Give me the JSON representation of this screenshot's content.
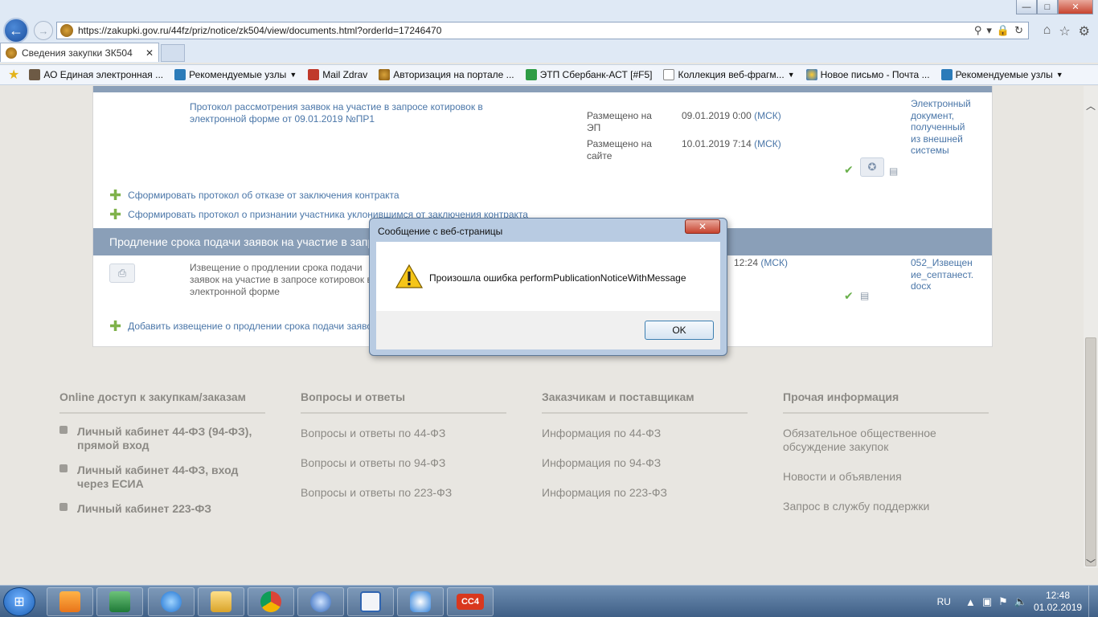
{
  "browser": {
    "url": "https://zakupki.gov.ru/44fz/priz/notice/zk504/view/documents.html?orderId=17246470",
    "tab_title": "Сведения закупки ЗК504",
    "window_controls": {
      "minimize": "—",
      "maximize": "□",
      "close": "✕"
    }
  },
  "favorites": [
    {
      "label": "АО Единая электронная ...",
      "icon": "gavel-icon",
      "dropdown": false
    },
    {
      "label": "Рекомендуемые узлы",
      "icon": "bing-icon",
      "dropdown": true
    },
    {
      "label": "Mail Zdrav",
      "icon": "mail-zdrav-icon",
      "dropdown": false
    },
    {
      "label": "Авторизация на портале ...",
      "icon": "seal-icon",
      "dropdown": false
    },
    {
      "label": "ЭТП Сбербанк-АСТ [#F5]",
      "icon": "sber-icon",
      "dropdown": false
    },
    {
      "label": "Коллекция веб-фрагм...",
      "icon": "page-icon",
      "dropdown": true
    },
    {
      "label": "Новое письмо - Почта ...",
      "icon": "mail-icon",
      "dropdown": false
    },
    {
      "label": "Рекомендуемые узлы",
      "icon": "bing-icon",
      "dropdown": true
    }
  ],
  "document1": {
    "title": "Протокол рассмотрения заявок на участие в запросе котировок в электронной форме от 09.01.2019 №ПР1",
    "placed_ep_label": "Размещено на ЭП",
    "placed_ep_value": "09.01.2019 0:00",
    "placed_site_label": "Размещено на сайте",
    "placed_site_value": "10.01.2019 7:14",
    "tz": "(МСК)",
    "file_link": "Электронный документ, полученный из внешней системы"
  },
  "actions": [
    "Сформировать протокол об отказе от заключения контракта",
    "Сформировать протокол о признании участника уклонившимся от заключения контракта"
  ],
  "section2": {
    "title": "Продление срока подачи заявок на участие в запросе котировок",
    "doc_title": "Извещение о продлении срока подачи заявок на участие в запросе котировок в электронной форме",
    "time_value": "12:24",
    "tz": "(МСК)",
    "file_link": "052_Извещение_септанест.docx",
    "add_action": "Добавить извещение о продлении срока подачи заявок"
  },
  "footer": {
    "columns": [
      {
        "head": "Online доступ к закупкам/заказам",
        "items": [
          "Личный кабинет 44-ФЗ (94-ФЗ), прямой вход",
          "Личный кабинет 44-ФЗ, вход через ЕСИА",
          "Личный кабинет 223-ФЗ"
        ]
      },
      {
        "head": "Вопросы и ответы",
        "items": [
          "Вопросы и ответы по 44-ФЗ",
          "Вопросы и ответы по 94-ФЗ",
          "Вопросы и ответы по 223-ФЗ"
        ]
      },
      {
        "head": "Заказчикам и поставщикам",
        "items": [
          "Информация по 44-ФЗ",
          "Информация по 94-ФЗ",
          "Информация по 223-ФЗ"
        ]
      },
      {
        "head": "Прочая информация",
        "items": [
          "Обязательное общественное обсуждение закупок",
          "Новости и объявления",
          "Запрос в службу поддержки"
        ]
      }
    ]
  },
  "dialog": {
    "title": "Сообщение с веб-страницы",
    "message": "Произошла ошибка performPublicationNoticeWithMessage",
    "ok_label": "OK",
    "close_label": "✕",
    "icon": "warning-icon"
  },
  "taskbar": {
    "lang": "RU",
    "time": "12:48",
    "date": "01.02.2019",
    "apps": [
      "media-player-icon",
      "excel-icon",
      "ie-icon",
      "explorer-icon",
      "chrome-icon",
      "mail-client-icon",
      "remote-icon",
      "sync-icon",
      "cc4-icon"
    ],
    "cc4_label": "CC4"
  },
  "colors": {
    "section_header": "#8a9fb8",
    "link": "#4a76a8",
    "footer_bg": "#e8e6e1",
    "dialog_frame": "#b8cbe2"
  }
}
